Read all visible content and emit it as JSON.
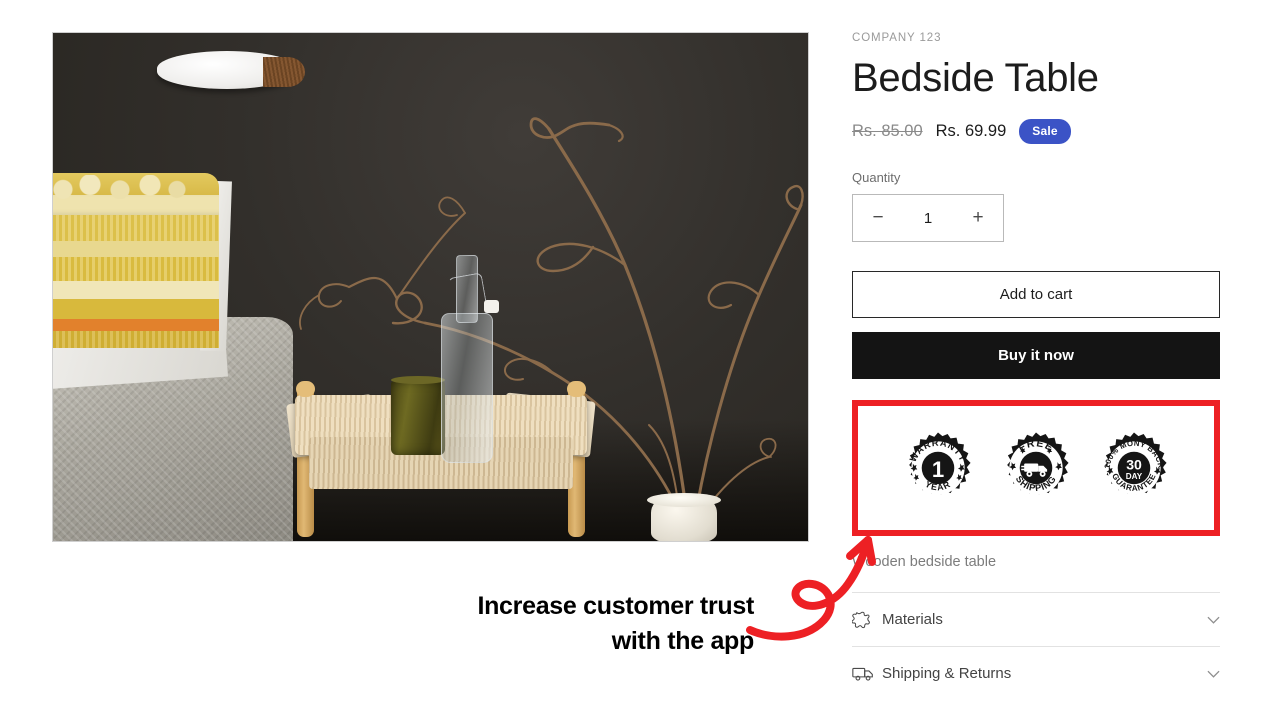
{
  "product": {
    "vendor": "COMPANY 123",
    "title": "Bedside Table",
    "price_compare": "Rs. 85.00",
    "price_current": "Rs. 69.99",
    "sale_badge": "Sale",
    "description": "Wooden bedside table",
    "image_alt": "Wooden bedside table styled with glass bottle, tumbler and dried branches against a dark wall"
  },
  "quantity": {
    "label": "Quantity",
    "value": "1",
    "decrease_label": "−",
    "increase_label": "+",
    "decrease_icon": "minus-icon",
    "increase_icon": "plus-icon"
  },
  "actions": {
    "add_to_cart": "Add to cart",
    "buy_it_now": "Buy it now"
  },
  "trust_badges": {
    "highlight_color": "#ed2024",
    "items": [
      {
        "id": "warranty-seal",
        "top_text": "WARRANTY",
        "center_text": "1",
        "bottom_text": "YEAR",
        "icon": "warranty-seal-icon"
      },
      {
        "id": "free-shipping-seal",
        "top_text": "FREE",
        "center_text": "",
        "bottom_text": "SHIPPING",
        "icon": "truck-seal-icon"
      },
      {
        "id": "money-back-seal",
        "top_text": "100% MONY BACK",
        "center_text": "30",
        "center_subtext": "DAY",
        "bottom_text": "GUARANTEE",
        "icon": "money-back-seal-icon"
      }
    ]
  },
  "accordions": [
    {
      "label": "Materials",
      "icon": "hide-leather-icon",
      "chevron": "chevron-down-icon"
    },
    {
      "label": "Shipping & Returns",
      "icon": "truck-icon",
      "chevron": "chevron-down-icon"
    }
  ],
  "annotation": {
    "line1": "Increase customer trust",
    "line2": "with the app",
    "arrow_icon": "curly-arrow-icon",
    "color": "#ed2024"
  },
  "theme": {
    "accent_sale": "#3b53c6",
    "buy_button_bg": "#141414",
    "highlight_red": "#ed2024",
    "text_primary": "#1c1c1c",
    "text_muted": "#7c7c7c"
  }
}
